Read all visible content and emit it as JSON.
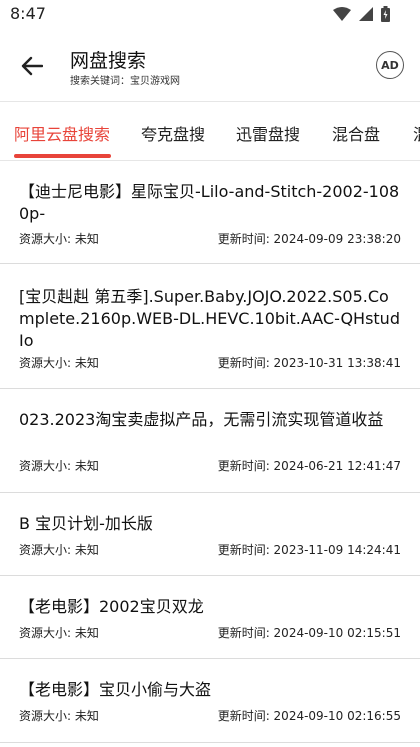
{
  "status": {
    "time": "8:47"
  },
  "header": {
    "title": "网盘搜索",
    "subtitle_label": "搜索关键词：",
    "subtitle_keyword": "宝贝游戏网",
    "ad_label": "AD"
  },
  "tabs": [
    {
      "label": "阿里云盘搜索",
      "active": true
    },
    {
      "label": "夸克盘搜",
      "active": false
    },
    {
      "label": "迅雷盘搜",
      "active": false
    },
    {
      "label": "混合盘",
      "active": false
    },
    {
      "label": "混",
      "active": false
    }
  ],
  "meta_labels": {
    "size_label": "资源大小: 未知"
  },
  "results": [
    {
      "title": "【迪士尼电影】星际宝贝-Lilo-and-Stitch-2002-1080p-",
      "time": "更新时间: 2024-09-09 23:38:20"
    },
    {
      "title": "[宝贝赳赳 第五季].Super.Baby.JOJO.2022.S05.Complete.2160p.WEB-DL.HEVC.10bit.AAC-QHstudIo",
      "time": "更新时间: 2023-10-31 13:38:41"
    },
    {
      "title": "023.2023淘宝卖虚拟产品，无需引流实现管道收益",
      "time": "更新时间: 2024-06-21 12:41:47"
    },
    {
      "title": "B 宝贝计划-加长版",
      "time": "更新时间: 2023-11-09 14:24:41"
    },
    {
      "title": "【老电影】2002宝贝双龙",
      "time": "更新时间: 2024-09-10 02:15:51"
    },
    {
      "title": "【老电影】宝贝小偷与大盗",
      "time": "更新时间: 2024-09-10 02:16:55"
    }
  ],
  "colors": {
    "accent": "#e8443a",
    "divider": "#dcdcdc"
  },
  "icons": [
    "wifi-icon",
    "signal-icon",
    "battery-icon",
    "back-arrow-icon"
  ]
}
